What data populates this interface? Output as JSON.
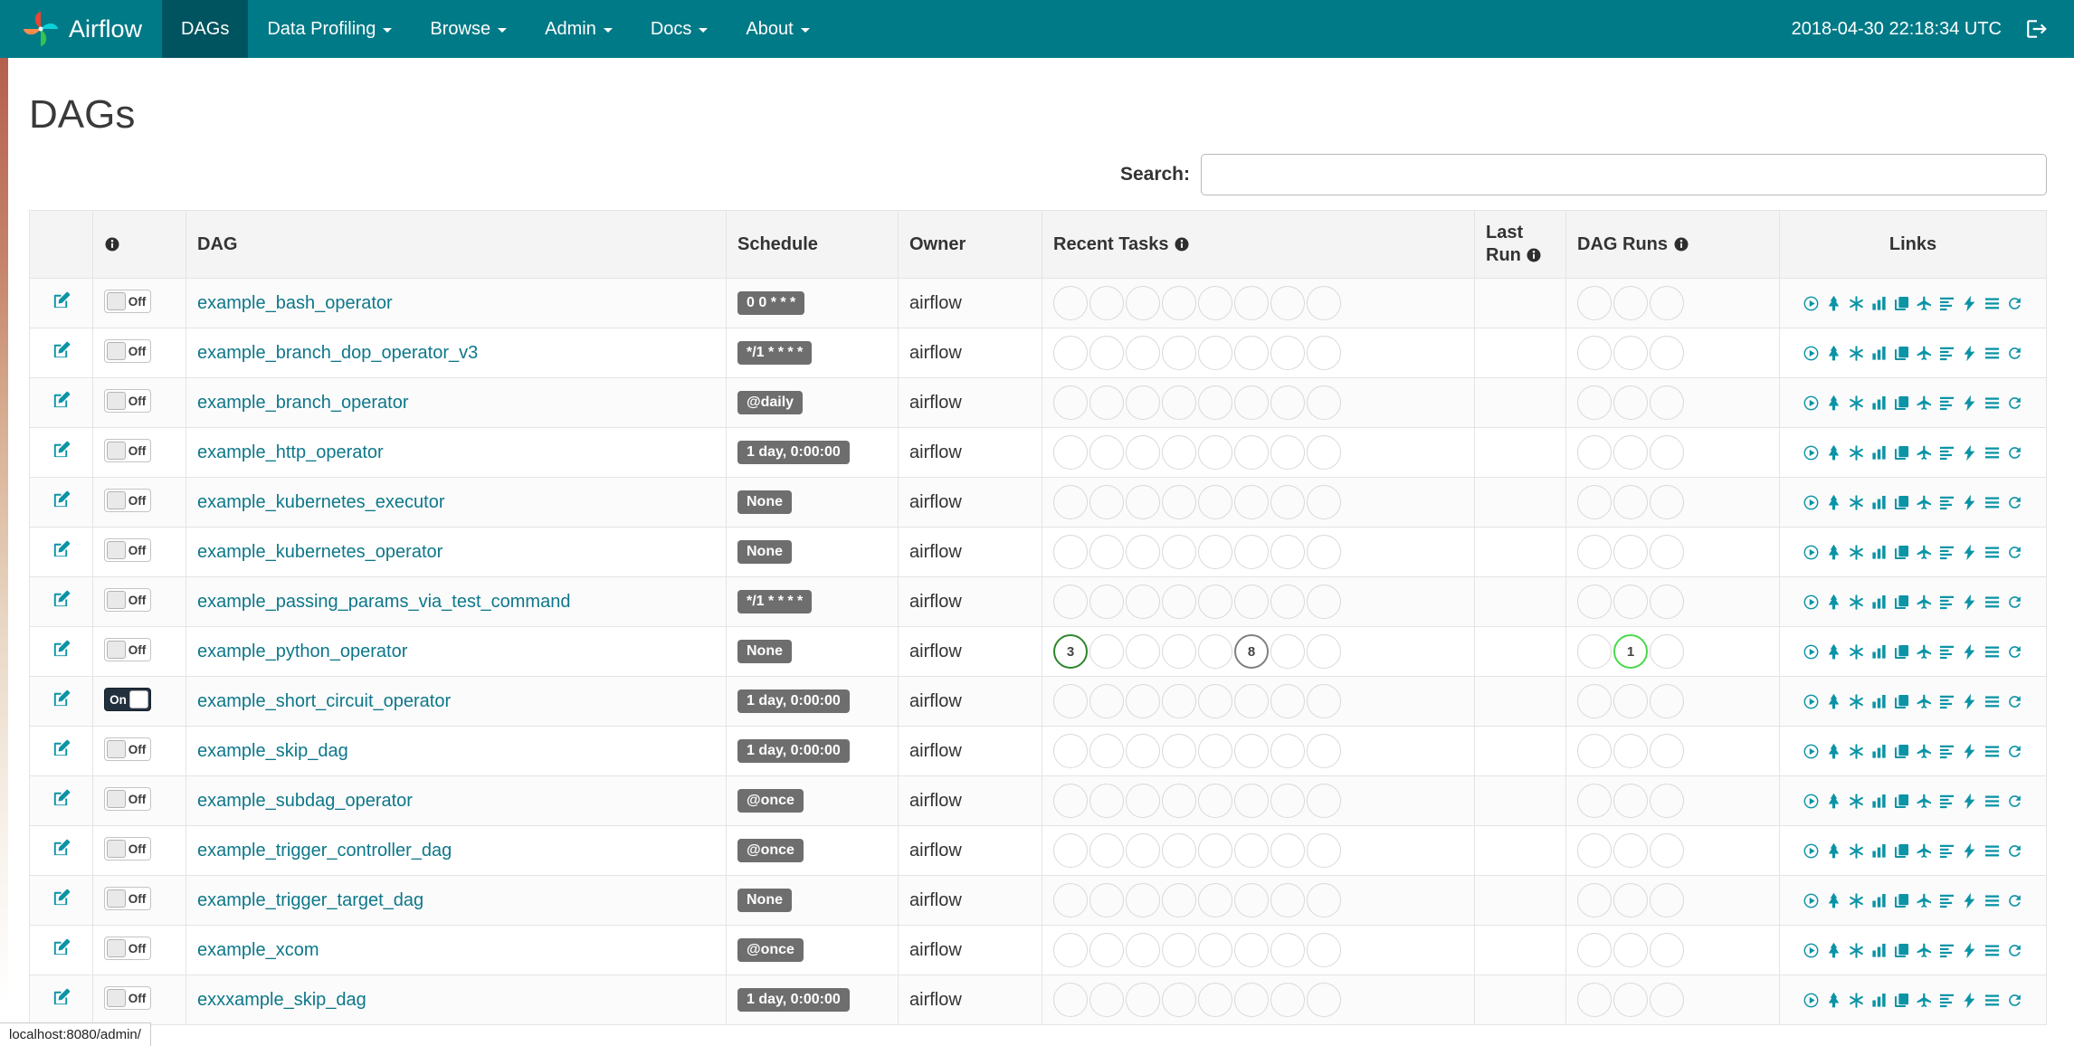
{
  "navbar": {
    "brand": "Airflow",
    "logo": "pinwheel-logo",
    "items": [
      {
        "label": "DAGs",
        "active": true,
        "caret": false
      },
      {
        "label": "Data Profiling",
        "active": false,
        "caret": true
      },
      {
        "label": "Browse",
        "active": false,
        "caret": true
      },
      {
        "label": "Admin",
        "active": false,
        "caret": true
      },
      {
        "label": "Docs",
        "active": false,
        "caret": true
      },
      {
        "label": "About",
        "active": false,
        "caret": true
      }
    ],
    "clock": "2018-04-30 22:18:34 UTC",
    "logout_icon": "sign-out-icon"
  },
  "page": {
    "title": "DAGs"
  },
  "search": {
    "label": "Search:",
    "value": ""
  },
  "table": {
    "headers": {
      "dag": "DAG",
      "schedule": "Schedule",
      "owner": "Owner",
      "recent_tasks": "Recent Tasks",
      "last_run": "Last Run",
      "dag_runs": "DAG Runs",
      "links": "Links"
    },
    "recent_tasks_slots": 8,
    "dag_runs_slots": 3,
    "toggle_labels": {
      "on": "On",
      "off": "Off"
    },
    "links": [
      {
        "name": "trigger-dag",
        "icon": "play-circle"
      },
      {
        "name": "tree-view",
        "icon": "tree"
      },
      {
        "name": "graph-view",
        "icon": "graph"
      },
      {
        "name": "task-duration",
        "icon": "bar-chart"
      },
      {
        "name": "task-tries",
        "icon": "duplicate"
      },
      {
        "name": "landing-times",
        "icon": "plane"
      },
      {
        "name": "gantt-view",
        "icon": "gantt"
      },
      {
        "name": "code-view",
        "icon": "bolt"
      },
      {
        "name": "logs",
        "icon": "list"
      },
      {
        "name": "refresh",
        "icon": "refresh"
      }
    ],
    "rows": [
      {
        "name": "example_bash_operator",
        "schedule": "0 0 * * *",
        "owner": "airflow",
        "paused": true,
        "recent_tasks": [],
        "dag_runs": []
      },
      {
        "name": "example_branch_dop_operator_v3",
        "schedule": "*/1 * * * *",
        "owner": "airflow",
        "paused": true,
        "recent_tasks": [],
        "dag_runs": []
      },
      {
        "name": "example_branch_operator",
        "schedule": "@daily",
        "owner": "airflow",
        "paused": true,
        "recent_tasks": [],
        "dag_runs": []
      },
      {
        "name": "example_http_operator",
        "schedule": "1 day, 0:00:00",
        "owner": "airflow",
        "paused": true,
        "recent_tasks": [],
        "dag_runs": []
      },
      {
        "name": "example_kubernetes_executor",
        "schedule": "None",
        "owner": "airflow",
        "paused": true,
        "recent_tasks": [],
        "dag_runs": []
      },
      {
        "name": "example_kubernetes_operator",
        "schedule": "None",
        "owner": "airflow",
        "paused": true,
        "recent_tasks": [],
        "dag_runs": []
      },
      {
        "name": "example_passing_params_via_test_command",
        "schedule": "*/1 * * * *",
        "owner": "airflow",
        "paused": true,
        "recent_tasks": [],
        "dag_runs": []
      },
      {
        "name": "example_python_operator",
        "schedule": "None",
        "owner": "airflow",
        "paused": true,
        "recent_tasks": [
          {
            "slot": 0,
            "count": "3",
            "color": "#2d862d",
            "state": "success"
          },
          {
            "slot": 5,
            "count": "8",
            "color": "#808080",
            "state": "queued"
          }
        ],
        "dag_runs": [
          {
            "slot": 1,
            "count": "1",
            "color": "#4ad94a",
            "state": "running"
          }
        ]
      },
      {
        "name": "example_short_circuit_operator",
        "schedule": "1 day, 0:00:00",
        "owner": "airflow",
        "paused": false,
        "recent_tasks": [],
        "dag_runs": []
      },
      {
        "name": "example_skip_dag",
        "schedule": "1 day, 0:00:00",
        "owner": "airflow",
        "paused": true,
        "recent_tasks": [],
        "dag_runs": []
      },
      {
        "name": "example_subdag_operator",
        "schedule": "@once",
        "owner": "airflow",
        "paused": true,
        "recent_tasks": [],
        "dag_runs": []
      },
      {
        "name": "example_trigger_controller_dag",
        "schedule": "@once",
        "owner": "airflow",
        "paused": true,
        "recent_tasks": [],
        "dag_runs": []
      },
      {
        "name": "example_trigger_target_dag",
        "schedule": "None",
        "owner": "airflow",
        "paused": true,
        "recent_tasks": [],
        "dag_runs": []
      },
      {
        "name": "example_xcom",
        "schedule": "@once",
        "owner": "airflow",
        "paused": true,
        "recent_tasks": [],
        "dag_runs": []
      },
      {
        "name": "exxxample_skip_dag",
        "schedule": "1 day, 0:00:00",
        "owner": "airflow",
        "paused": true,
        "recent_tasks": [],
        "dag_runs": []
      }
    ]
  },
  "statusbar": {
    "text": "localhost:8080/admin/"
  },
  "colors": {
    "navbar": "#007A87",
    "navbar_active": "#00545f",
    "link": "#0d778a",
    "icon": "#0b93a6",
    "badge_bg": "#6e6e6e",
    "circle_border": "#d9d9d9",
    "success": "#2d862d",
    "running": "#4ad94a",
    "queued": "#808080"
  }
}
